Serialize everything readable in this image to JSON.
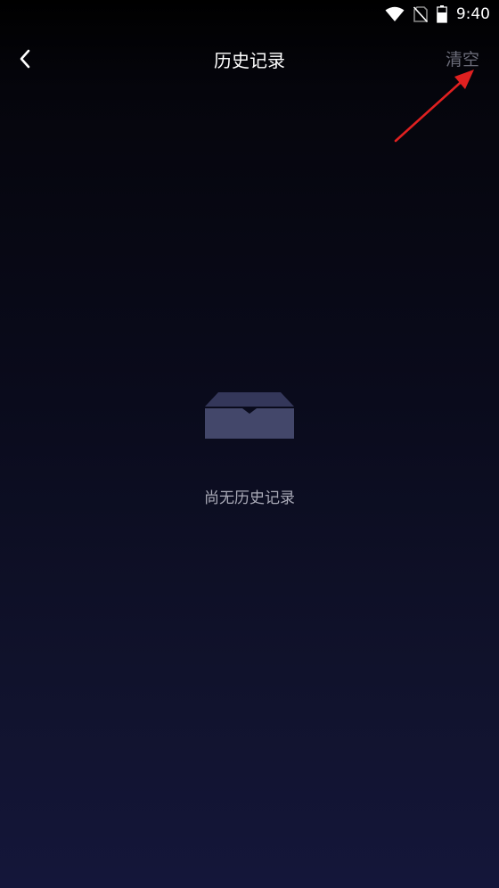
{
  "status_bar": {
    "time": "9:40",
    "icons": [
      "wifi-icon",
      "no-sim-icon",
      "battery-icon"
    ]
  },
  "nav": {
    "back_icon": "chevron-left-icon",
    "title": "历史记录",
    "clear_label": "清空"
  },
  "empty_state": {
    "icon": "empty-tray-icon",
    "message": "尚无历史记录"
  },
  "colors": {
    "background_top": "#000000",
    "background_bottom": "#14163a",
    "clear_text": "#6a6b78",
    "empty_text": "#a9aab7",
    "annotation_arrow": "#e02020"
  }
}
